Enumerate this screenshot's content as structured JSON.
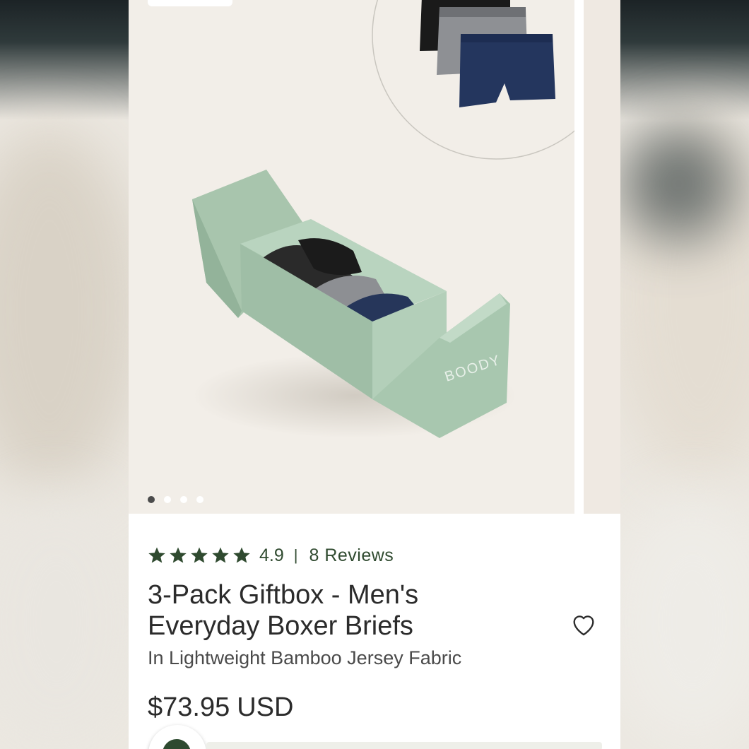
{
  "gallery": {
    "slide_count": 4,
    "active_index": 0,
    "box_brand": "BOODY"
  },
  "product": {
    "rating_value": "4.9",
    "rating_separator": "|",
    "reviews_label": "8 Reviews",
    "title_line1": "3-Pack Giftbox - Men's",
    "title_line2": "Everyday Boxer Briefs",
    "subtitle": "In Lightweight Bamboo Jersey Fabric",
    "price": "$73.95",
    "currency": "USD",
    "stars_filled": 5
  },
  "colors": {
    "accent": "#2f4a2f",
    "box_green": "#a9c8b0"
  }
}
